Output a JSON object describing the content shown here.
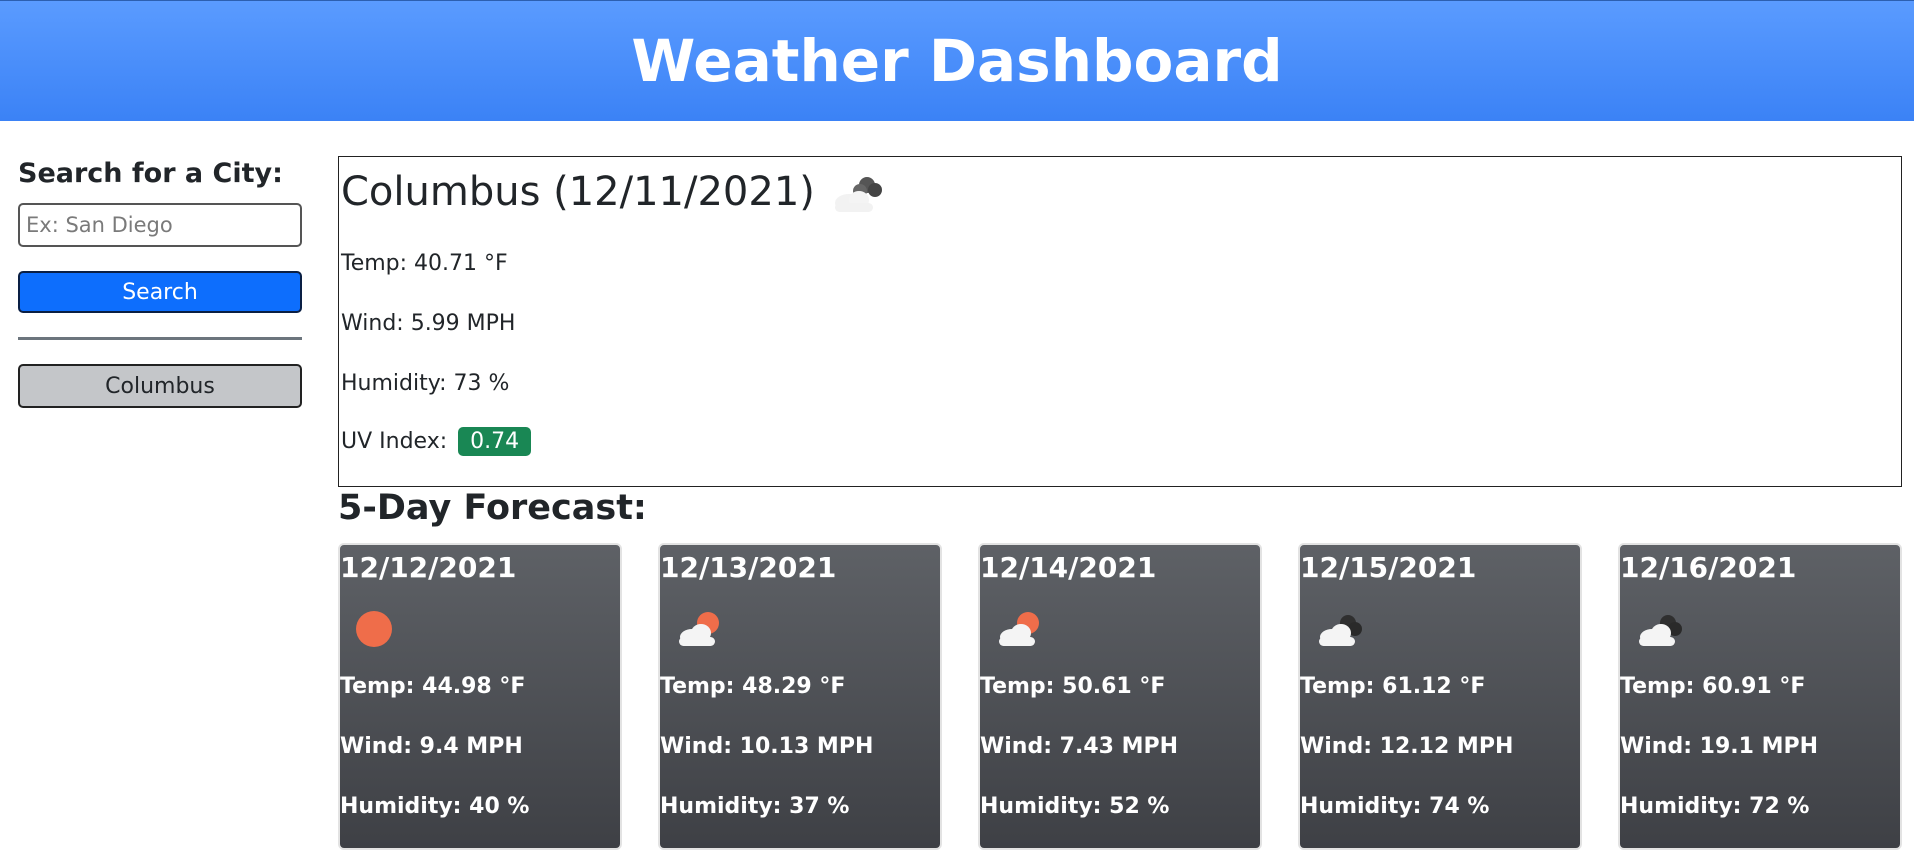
{
  "header": {
    "title": "Weather Dashboard"
  },
  "sidebar": {
    "heading": "Search for a City:",
    "search_placeholder": "Ex: San Diego",
    "search_value": "",
    "search_button": "Search",
    "history": [
      "Columbus"
    ]
  },
  "current": {
    "title": "Columbus (12/11/2021)",
    "icon": "cloudy-icon",
    "temp": "Temp: 40.71 °F",
    "wind": "Wind: 5.99 MPH",
    "humidity": "Humidity: 73 %",
    "uv_label": "UV Index:",
    "uv_value": "0.74",
    "uv_color": "#198754"
  },
  "forecast": {
    "title": "5-Day Forecast:",
    "days": [
      {
        "date": "12/12/2021",
        "icon": "sun-icon",
        "temp": "Temp: 44.98 °F",
        "wind": "Wind: 9.4 MPH",
        "humidity": "Humidity: 40 %"
      },
      {
        "date": "12/13/2021",
        "icon": "partly-cloudy-icon",
        "temp": "Temp: 48.29 °F",
        "wind": "Wind: 10.13 MPH",
        "humidity": "Humidity: 37 %"
      },
      {
        "date": "12/14/2021",
        "icon": "partly-cloudy-icon",
        "temp": "Temp: 50.61 °F",
        "wind": "Wind: 7.43 MPH",
        "humidity": "Humidity: 52 %"
      },
      {
        "date": "12/15/2021",
        "icon": "cloudy-icon",
        "temp": "Temp: 61.12 °F",
        "wind": "Wind: 12.12 MPH",
        "humidity": "Humidity: 74 %"
      },
      {
        "date": "12/16/2021",
        "icon": "cloudy-icon",
        "temp": "Temp: 60.91 °F",
        "wind": "Wind: 19.1 MPH",
        "humidity": "Humidity: 72 %"
      }
    ]
  }
}
